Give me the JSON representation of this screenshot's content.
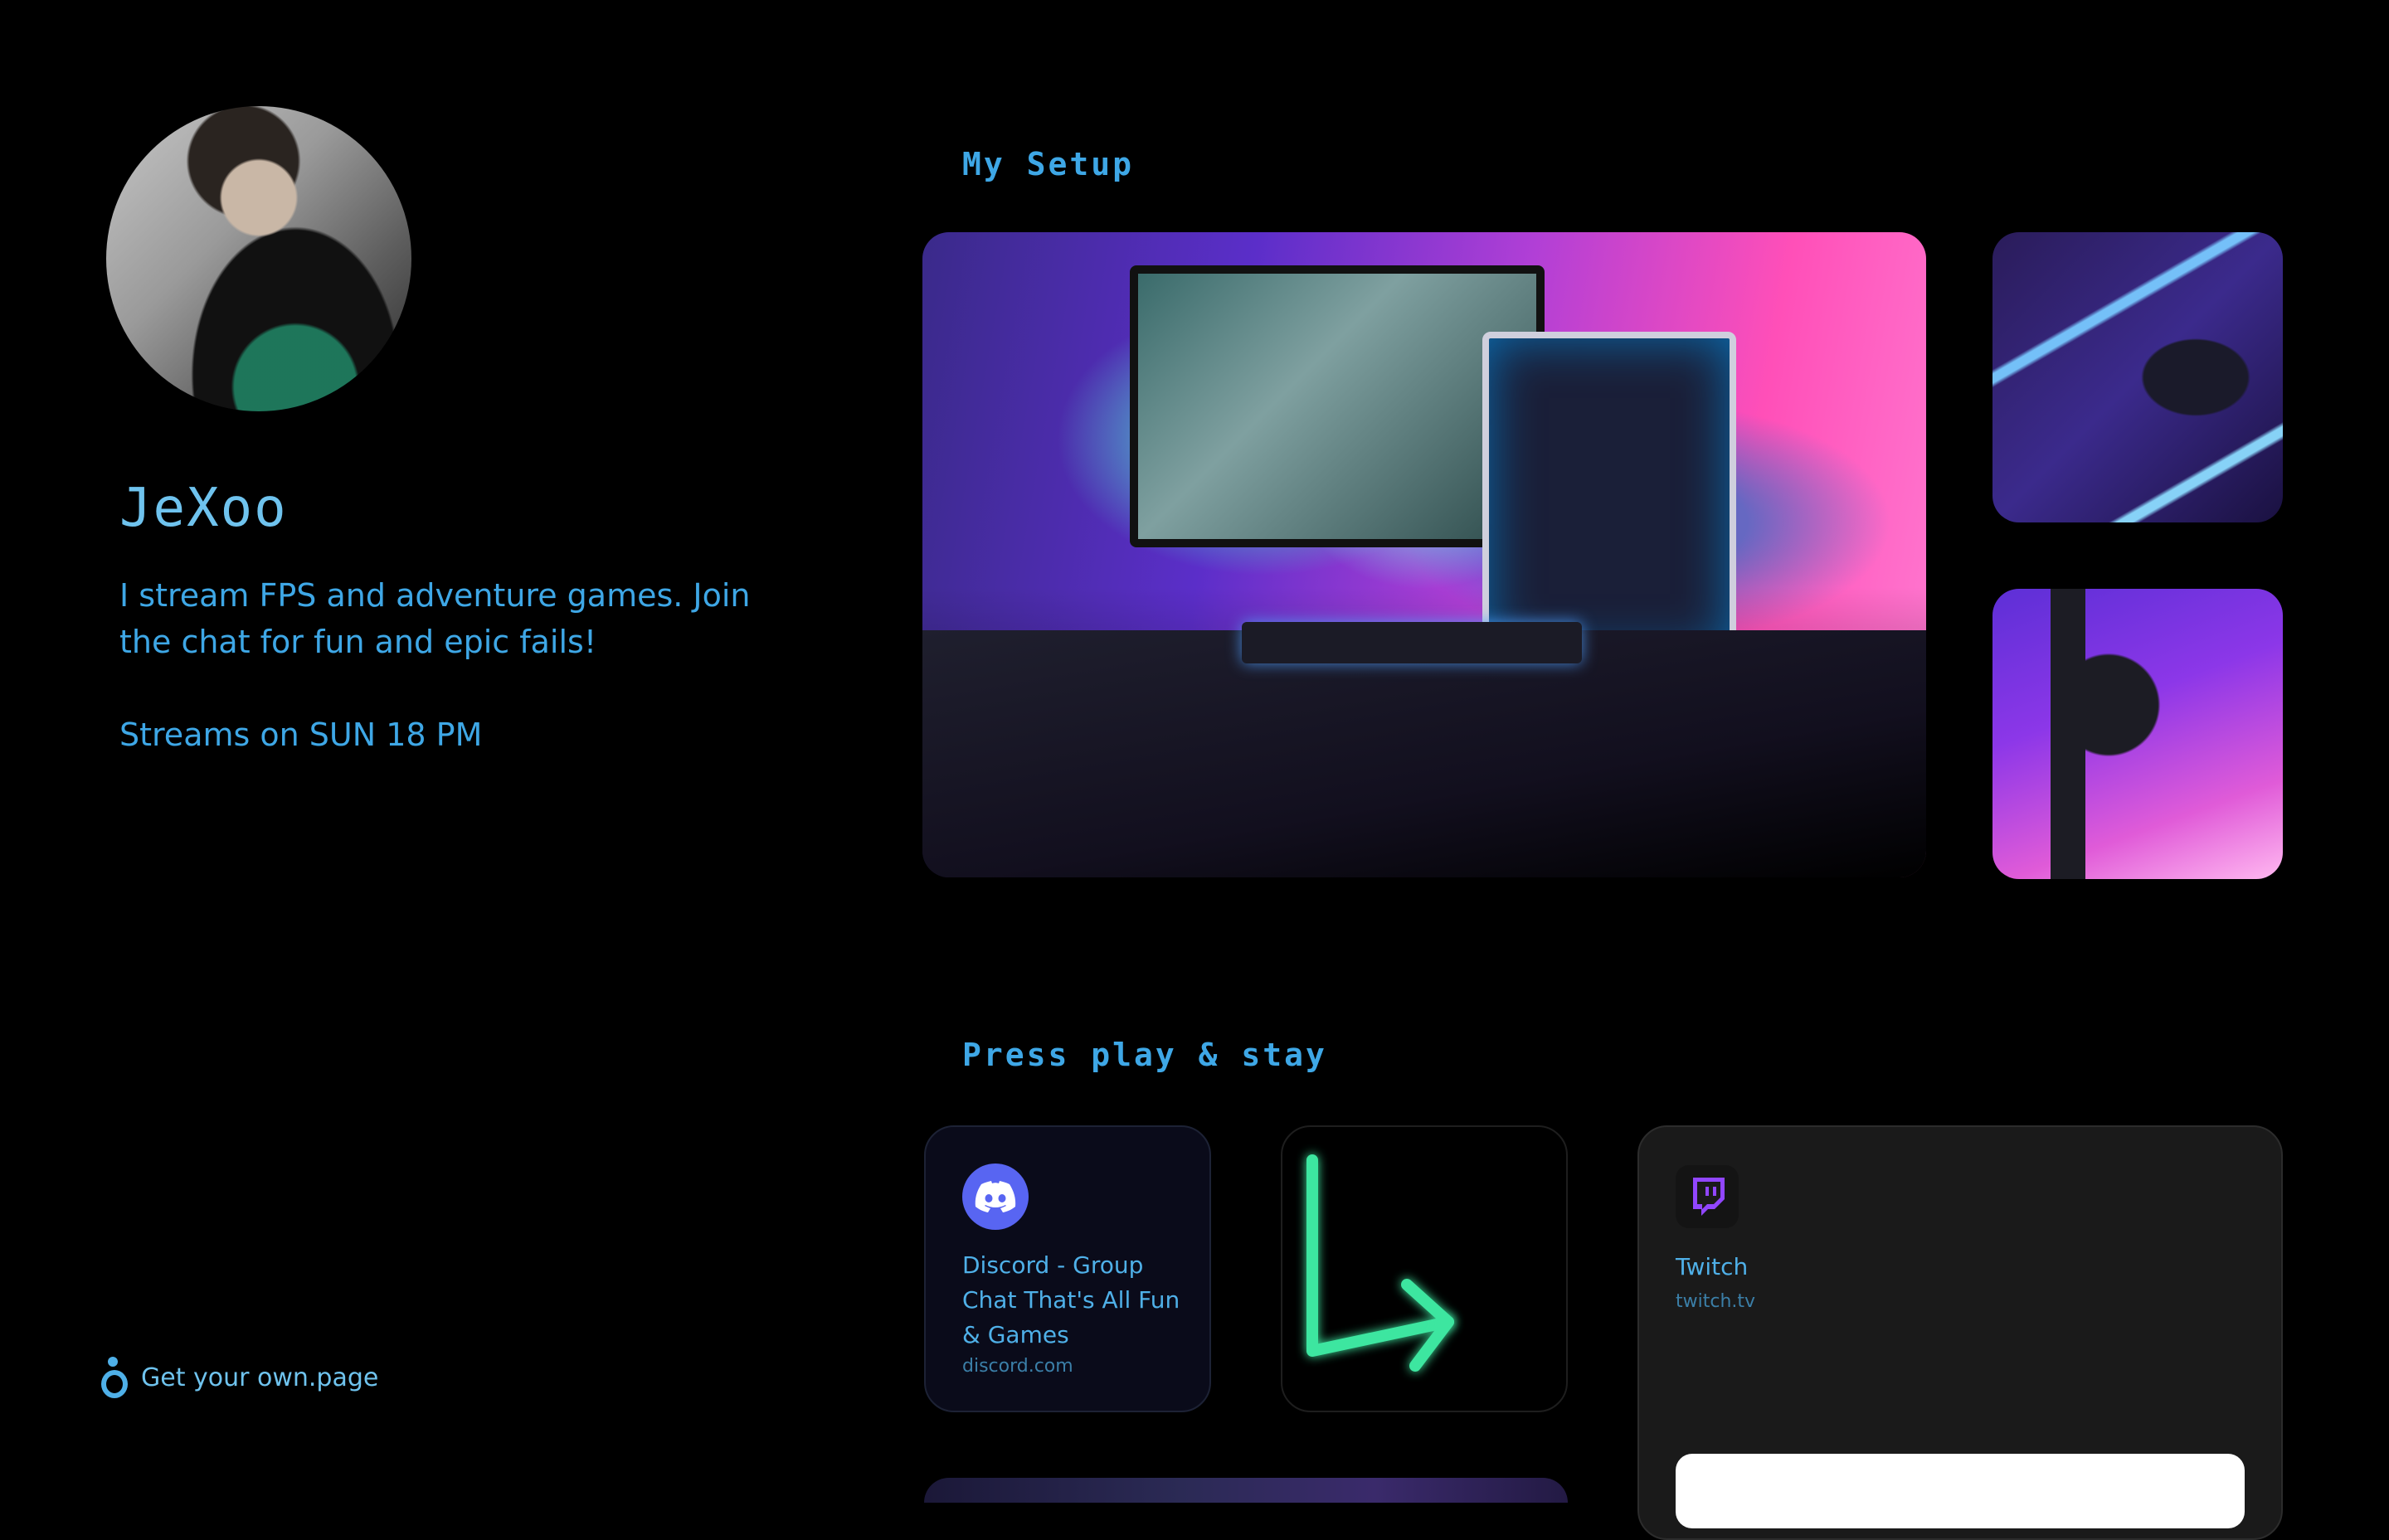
{
  "profile": {
    "name": "JeXoo",
    "bio": "I stream FPS and adventure games. Join the chat for fun and epic fails!",
    "schedule": "Streams on SUN 18 PM"
  },
  "footer": {
    "cta_label": "Get your own.page",
    "cta_icon": "person-icon"
  },
  "sections": {
    "setup_title": "My Setup",
    "links_title": "Press play & stay"
  },
  "links": [
    {
      "title": "Discord - Group Chat That's All Fun & Games",
      "url": "discord.com",
      "icon": "discord-icon"
    },
    {
      "title": "",
      "url": "",
      "icon": "neon-arrow-icon"
    },
    {
      "title": "Twitch",
      "url": "twitch.tv",
      "icon": "twitch-icon"
    }
  ],
  "colors": {
    "background": "#000000",
    "accent": "#3ea7e6",
    "discord": "#5865f2",
    "twitch": "#9146ff",
    "neon_green": "#3ee6a0"
  }
}
